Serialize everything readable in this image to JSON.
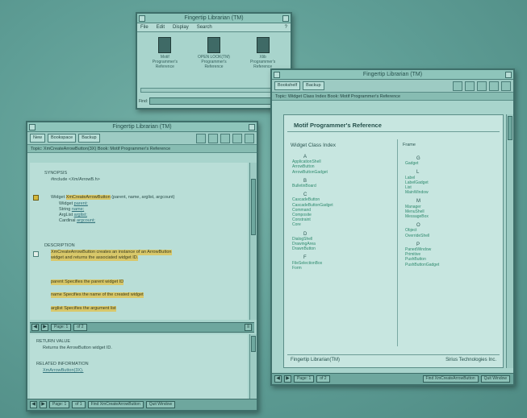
{
  "top_window": {
    "title": "Fingertip Librarian (TM)",
    "menu": [
      "File",
      "Edit",
      "Display",
      "Search"
    ],
    "help": "?",
    "books": [
      {
        "line1": "Motif",
        "line2": "Programmer's",
        "line3": "Reference"
      },
      {
        "line1": "OPEN LOOK(TM)",
        "line2": "Programmer's",
        "line3": "Reference"
      },
      {
        "line1": "Xlib",
        "line2": "Programmer's",
        "line3": "Reference"
      }
    ],
    "find_label": "Find:"
  },
  "right_window": {
    "title": "Fingertip Librarian (TM)",
    "toolbar": [
      "Bookshelf",
      "Backup"
    ],
    "topic": "Topic: Widget Class Index  Book: Motif Programmer's Reference",
    "heading": "Motif Programmer's Reference",
    "index_title": "Widget Class Index",
    "frame_label": "Frame",
    "col1": [
      {
        "letter": "A",
        "items": [
          "ApplicationShell",
          "ArrowButton",
          "ArrowButtonGadget"
        ]
      },
      {
        "letter": "B",
        "items": [
          "BulletinBoard"
        ]
      },
      {
        "letter": "C",
        "items": [
          "CascadeButton",
          "CascadeButtonGadget",
          "Command",
          "Composite",
          "Constraint",
          "Core"
        ]
      },
      {
        "letter": "D",
        "items": [
          "DialogShell",
          "DrawingArea",
          "DrawnButton"
        ]
      },
      {
        "letter": "F",
        "items": [
          "FileSelectionBox",
          "Form"
        ]
      }
    ],
    "col2": [
      {
        "letter": "G",
        "items": [
          "Gadget"
        ]
      },
      {
        "letter": "L",
        "items": [
          "Label",
          "LabelGadget",
          "List",
          "MainWindow"
        ]
      },
      {
        "letter": "M",
        "items": [
          "Manager",
          "MenuShell",
          "MessageBox"
        ]
      },
      {
        "letter": "O",
        "items": [
          "Object",
          "OverrideShell"
        ]
      },
      {
        "letter": "P",
        "items": [
          "PanedWindow",
          "Primitive",
          "PushButton",
          "PushButtonGadget"
        ]
      }
    ],
    "footer_left": "Fingertip Librarian(TM)",
    "footer_right": "Sirius Technologies Inc.",
    "page_label": "Page: 1",
    "page_of": "of 2",
    "find_button": "Find XmCreateArrowButton",
    "quit_button": "Quit Window"
  },
  "left_window": {
    "title": "Fingertip Librarian (TM)",
    "toolbar": [
      "New",
      "Bookspace",
      "Backup"
    ],
    "topic": "Topic: XmCreateArrowButton(3X)  Book: Motif Programmer's Reference",
    "synopsis_head": "SYNOPSIS",
    "include": "#include <Xm/ArrowB.h>",
    "widget_line_prefix": "Widget",
    "function_name": "XmCreateArrowButton",
    "function_args": " (parent, name, arglist, argcount)",
    "params": [
      {
        "type": "Widget",
        "name": "parent;"
      },
      {
        "type": "String",
        "name": "name;"
      },
      {
        "type": "ArgList",
        "name": "arglist;"
      },
      {
        "type": "Cardinal",
        "name": "argcount;"
      }
    ],
    "description_head": "DESCRIPTION",
    "desc_line1": "XmCreateArrowButton creates an instance of an ArrowButton",
    "desc_line2": "widget and returns the associated widget ID.",
    "arg_parent": "parent Specifies the parent widget ID",
    "arg_name": "name Specifies the name of the created widget",
    "arg_arglist": "arglist Specifies the argument list",
    "mid_page_label": "Page: 1",
    "mid_page_of": "of 2",
    "return_head": "RETURN VALUE",
    "return_text": "Returns the ArrowButton widget ID.",
    "related_head": "RELATED INFORMATION",
    "related_text": "XmArrowButton(3X).",
    "page_label": "Page: 1",
    "page_of": "of 1",
    "find_button": "Find XmCreateArrowButton",
    "quit_button": "Quit Window"
  }
}
